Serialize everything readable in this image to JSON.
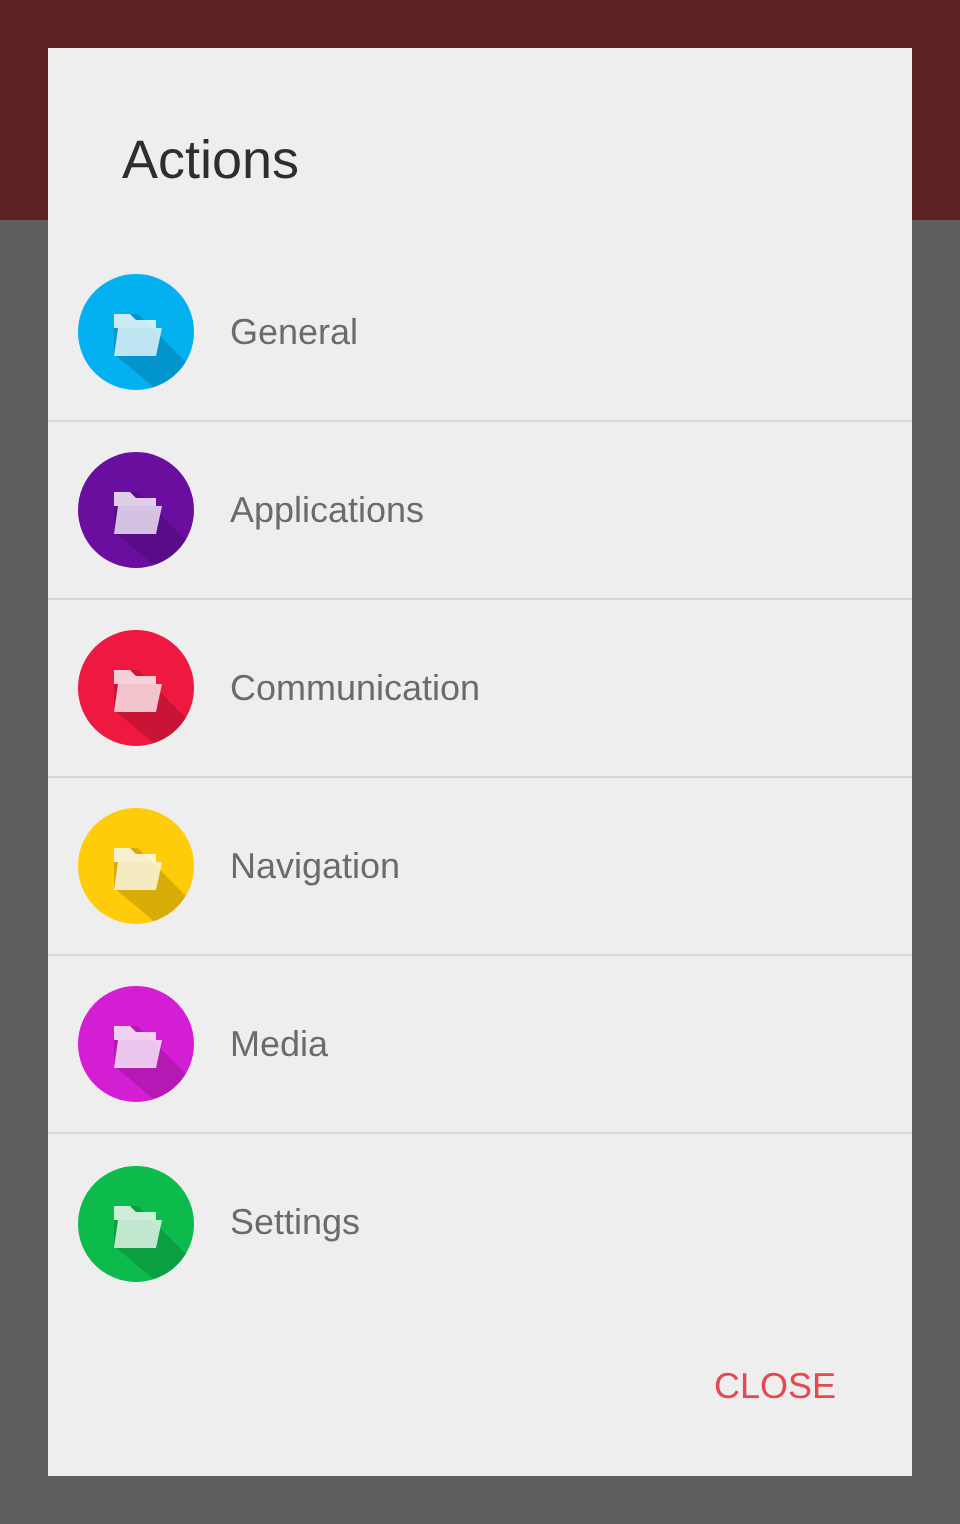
{
  "dialog": {
    "title": "Actions",
    "items": [
      {
        "label": "General",
        "color": "#03b0f0"
      },
      {
        "label": "Applications",
        "color": "#6a0ea0"
      },
      {
        "label": "Communication",
        "color": "#ee1840"
      },
      {
        "label": "Navigation",
        "color": "#ffcc0a"
      },
      {
        "label": "Media",
        "color": "#d41ed4"
      },
      {
        "label": "Settings",
        "color": "#0cbb4c"
      }
    ],
    "button": "CLOSE"
  }
}
